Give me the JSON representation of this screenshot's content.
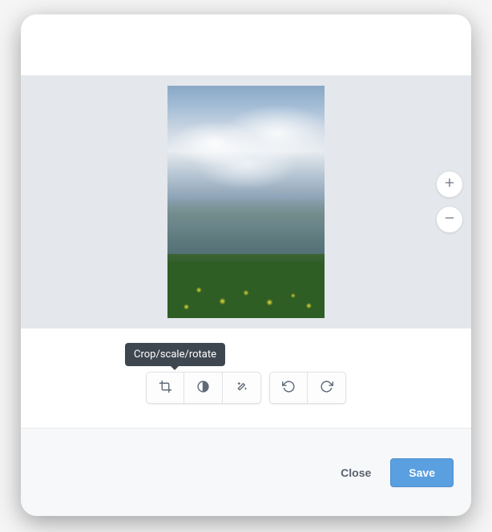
{
  "tooltip": {
    "crop": "Crop/scale/rotate"
  },
  "footer": {
    "close_label": "Close",
    "save_label": "Save"
  },
  "image": {
    "description": "Mountain landscape with clouds and yellow wildflowers"
  }
}
